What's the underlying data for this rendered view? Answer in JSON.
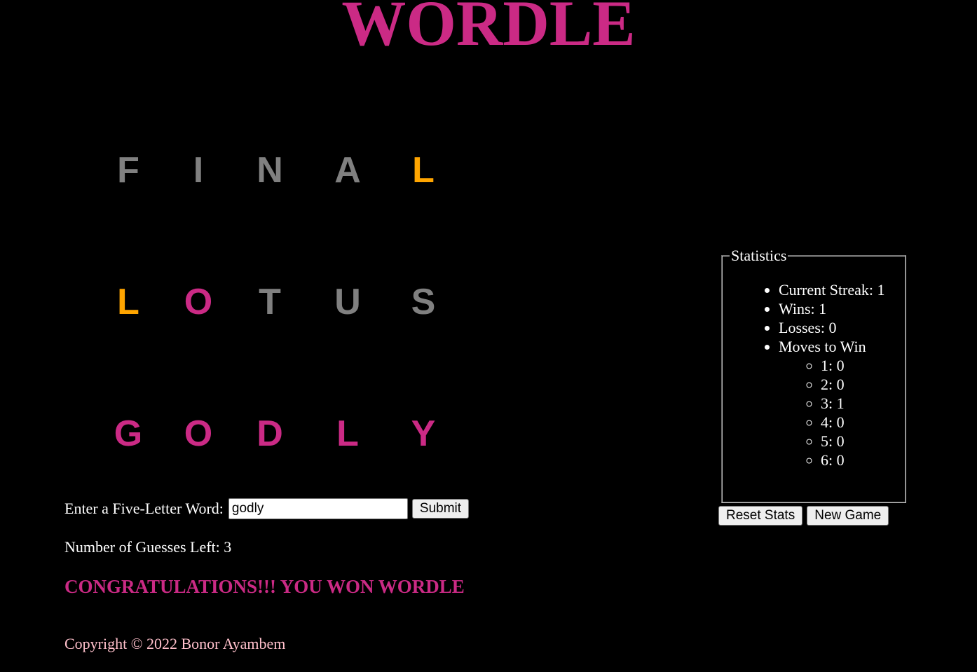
{
  "title": "WORDLE",
  "colors": {
    "absent": "#808080",
    "present": "#ffa500",
    "correct": "#cb2a85",
    "background": "#000000"
  },
  "board": [
    {
      "word": "FINAL",
      "tiles": [
        {
          "letter": "F",
          "state": "absent"
        },
        {
          "letter": "I",
          "state": "absent"
        },
        {
          "letter": "N",
          "state": "absent"
        },
        {
          "letter": "A",
          "state": "absent"
        },
        {
          "letter": "L",
          "state": "present"
        }
      ]
    },
    {
      "word": "LOTUS",
      "tiles": [
        {
          "letter": "L",
          "state": "present"
        },
        {
          "letter": "O",
          "state": "correct"
        },
        {
          "letter": "T",
          "state": "absent"
        },
        {
          "letter": "U",
          "state": "absent"
        },
        {
          "letter": "S",
          "state": "absent"
        }
      ]
    },
    {
      "word": "GODLY",
      "tiles": [
        {
          "letter": "G",
          "state": "correct"
        },
        {
          "letter": "O",
          "state": "correct"
        },
        {
          "letter": "D",
          "state": "correct"
        },
        {
          "letter": "L",
          "state": "correct"
        },
        {
          "letter": "Y",
          "state": "correct"
        }
      ]
    }
  ],
  "form": {
    "label": "Enter a Five-Letter Word:",
    "value": "godly",
    "submit_label": "Submit"
  },
  "guesses_left": "Number of Guesses Left: 3",
  "message": "CONGRATULATIONS!!! YOU WON WORDLE",
  "copyright": "Copyright © 2022 Bonor Ayambem",
  "statistics": {
    "legend": "Statistics",
    "current_streak": "Current Streak: 1",
    "wins": "Wins: 1",
    "losses": "Losses: 0",
    "moves_label": "Moves to Win",
    "moves": [
      "1: 0",
      "2: 0",
      "3: 1",
      "4: 0",
      "5: 0",
      "6: 0"
    ],
    "reset_label": "Reset Stats",
    "new_game_label": "New Game"
  }
}
